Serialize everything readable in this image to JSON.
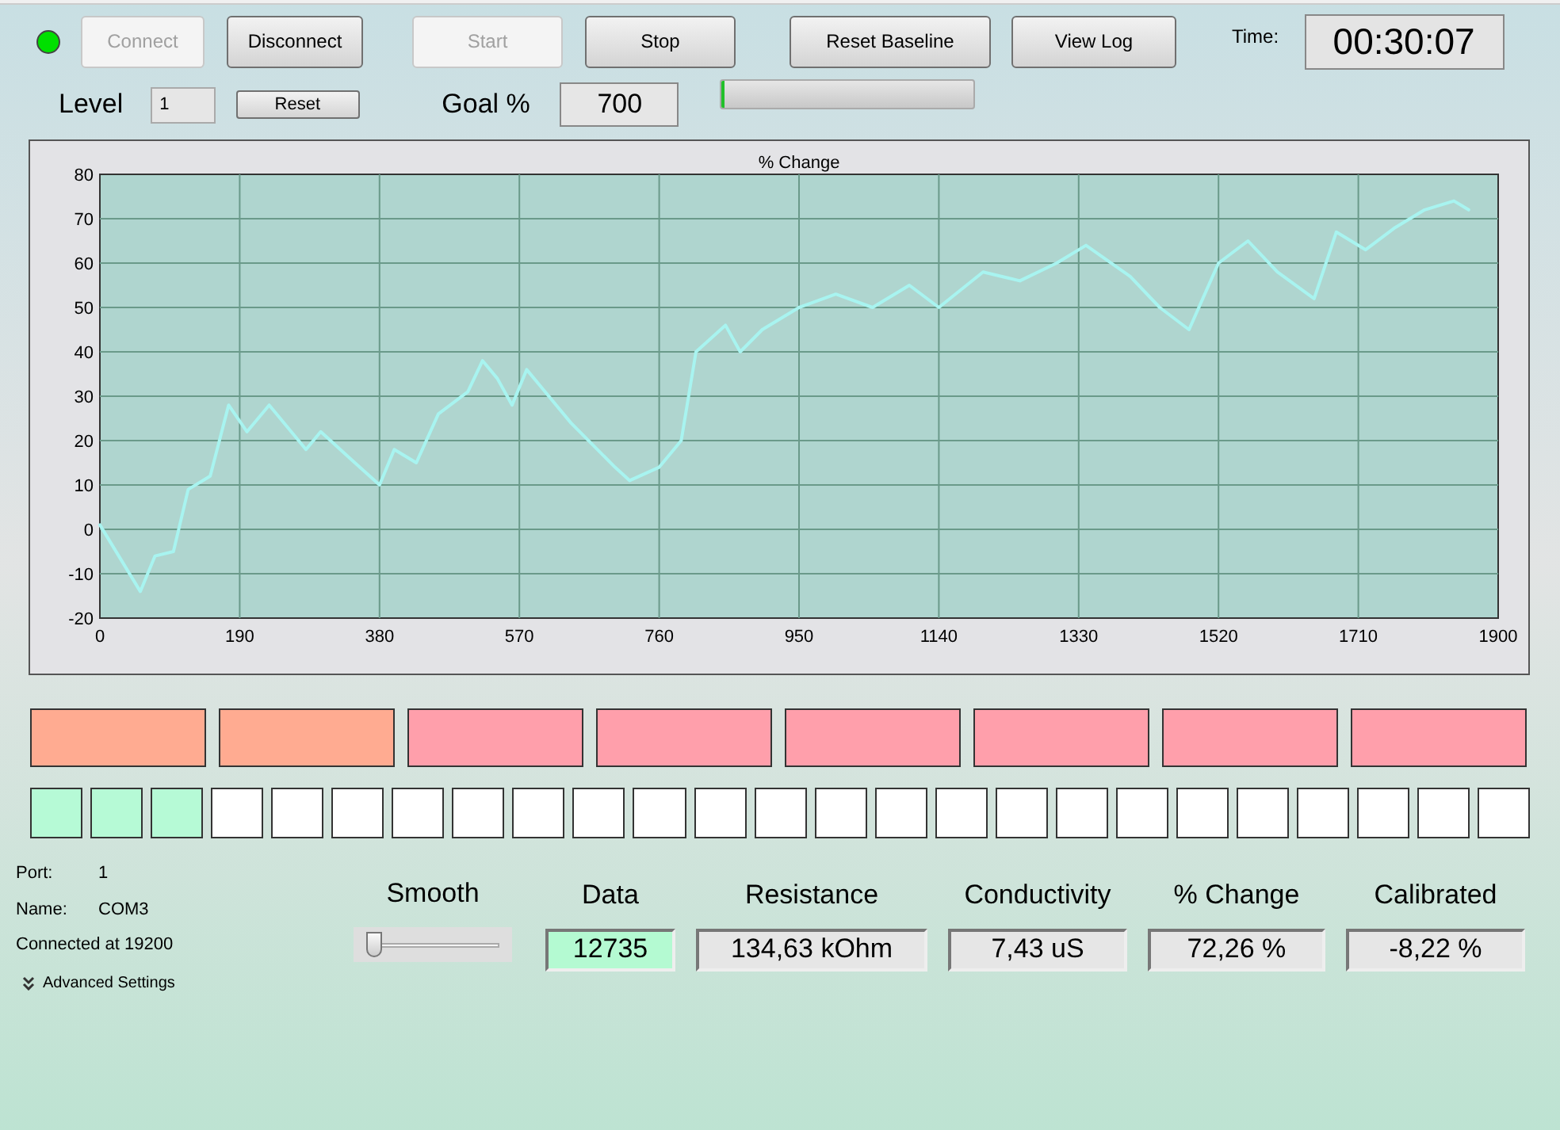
{
  "status_led": {
    "on": true,
    "color": "#00e000"
  },
  "top_buttons": [
    {
      "label": "Connect",
      "disabled": true
    },
    {
      "label": "Disconnect",
      "disabled": false
    },
    {
      "label": "Start",
      "disabled": true
    },
    {
      "label": "Stop",
      "disabled": false
    },
    {
      "label": "Reset Baseline",
      "disabled": false
    },
    {
      "label": "View Log",
      "disabled": false
    }
  ],
  "time": {
    "label": "Time:",
    "value": "00:30:07"
  },
  "level": {
    "label": "Level",
    "value": "1",
    "reset_button": "Reset"
  },
  "goal": {
    "label": "Goal %",
    "value": "700",
    "progress": {
      "level": 0.01
    }
  },
  "chart": {
    "chart_data": {
      "type": "line",
      "title": "% Change",
      "x": [
        0,
        55,
        75,
        100,
        120,
        150,
        175,
        200,
        230,
        280,
        300,
        340,
        380,
        400,
        430,
        460,
        500,
        520,
        540,
        560,
        580,
        600,
        640,
        700,
        720,
        760,
        790,
        810,
        850,
        870,
        900,
        950,
        1000,
        1050,
        1100,
        1140,
        1200,
        1250,
        1300,
        1340,
        1400,
        1440,
        1480,
        1520,
        1560,
        1600,
        1650,
        1680,
        1720,
        1760,
        1800,
        1840,
        1860
      ],
      "grid": true,
      "series": [
        {
          "color": "#a8f4f0",
          "values": [
            1,
            -14,
            -6,
            -5,
            9,
            12,
            28,
            22,
            28,
            18,
            22,
            16,
            10,
            18,
            15,
            26,
            31,
            38,
            34,
            28,
            36,
            32,
            24,
            14,
            11,
            14,
            20,
            40,
            46,
            40,
            45,
            50,
            53,
            50,
            55,
            50,
            58,
            56,
            60,
            64,
            57,
            50,
            45,
            60,
            65,
            58,
            52,
            67,
            63,
            68,
            72,
            74,
            72
          ]
        }
      ],
      "xlim": [
        0,
        1900
      ],
      "ylim": [
        -20,
        80
      ],
      "xticks": [
        0,
        190,
        380,
        570,
        760,
        950,
        1140,
        1330,
        1520,
        1710,
        1900
      ],
      "yticks": [
        -20,
        -10,
        0,
        10,
        20,
        30,
        40,
        50,
        60,
        70,
        80
      ]
    }
  },
  "level_blocks": [
    {
      "color": "#ffab91"
    },
    {
      "color": "#ffab91"
    },
    {
      "color": "#ff9fab"
    },
    {
      "color": "#ff9fab"
    },
    {
      "color": "#ff9fab"
    },
    {
      "color": "#ff9fab"
    },
    {
      "color": "#ff9fab"
    },
    {
      "color": "#ff9fab"
    }
  ],
  "progress_squares": [
    {
      "on": true
    },
    {
      "on": true
    },
    {
      "on": true
    },
    {
      "on": false
    },
    {
      "on": false
    },
    {
      "on": false
    },
    {
      "on": false
    },
    {
      "on": false
    },
    {
      "on": false
    },
    {
      "on": false
    },
    {
      "on": false
    },
    {
      "on": false
    },
    {
      "on": false
    },
    {
      "on": false
    },
    {
      "on": false
    },
    {
      "on": false
    },
    {
      "on": false
    },
    {
      "on": false
    },
    {
      "on": false
    },
    {
      "on": false
    },
    {
      "on": false
    },
    {
      "on": false
    },
    {
      "on": false
    },
    {
      "on": false
    },
    {
      "on": false
    }
  ],
  "port_info": [
    {
      "label": "Port:",
      "value": "1"
    },
    {
      "label": "Name:",
      "value": "COM3"
    }
  ],
  "connection": "Connected at 19200",
  "advanced_settings": "Advanced Settings",
  "smooth": {
    "label": "Smooth",
    "level": 0
  },
  "readouts": [
    {
      "label": "Data",
      "value": "12735",
      "highlighted": true
    },
    {
      "label": "Resistance",
      "value": "134,63 kOhm",
      "highlighted": false
    },
    {
      "label": "Conductivity",
      "value": "7,43 uS",
      "highlighted": false
    },
    {
      "label": "% Change",
      "value": "72,26 %",
      "highlighted": false
    },
    {
      "label": "Calibrated",
      "value": "-8,22 %",
      "highlighted": false
    }
  ]
}
